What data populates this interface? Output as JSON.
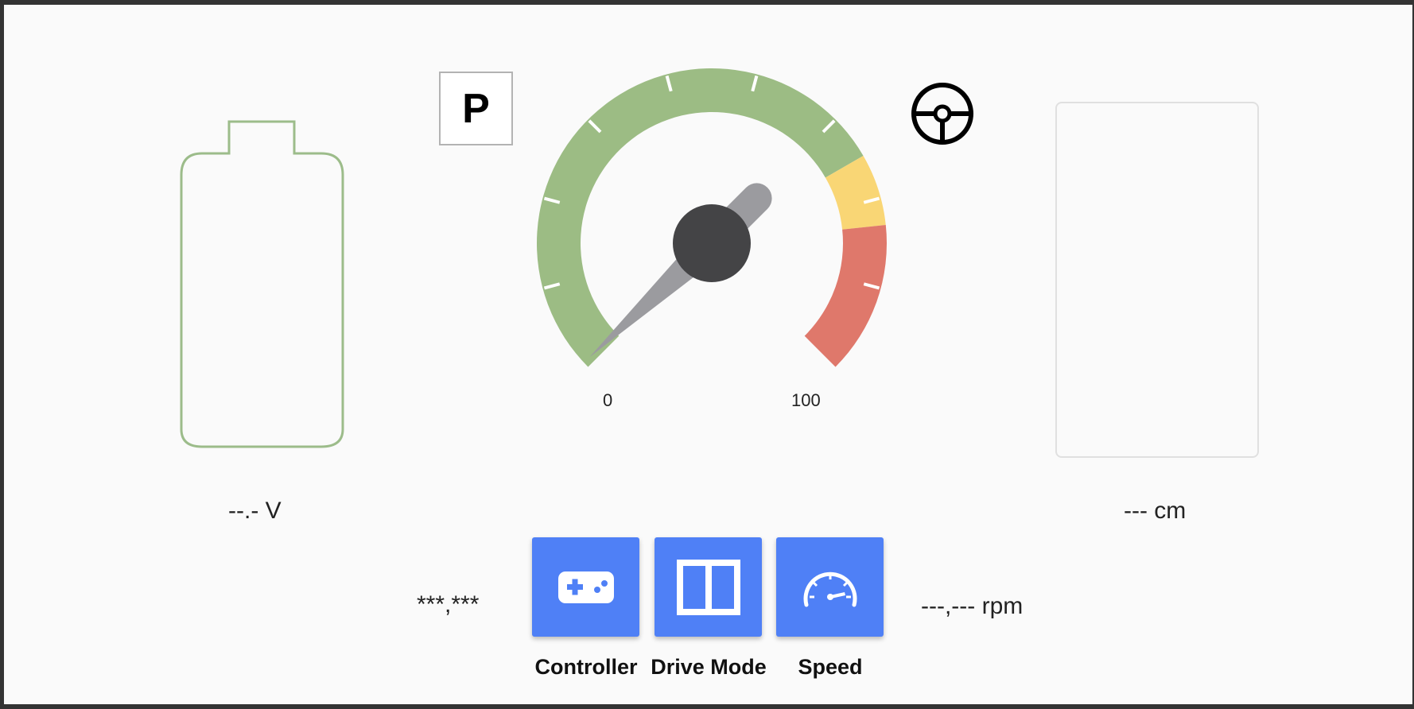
{
  "battery": {
    "voltage_text": "--.- V",
    "outline_color": "#9cbc8a"
  },
  "gear": {
    "label": "P"
  },
  "speedometer": {
    "min_label": "0",
    "max_label": "100",
    "zones": [
      {
        "name": "normal",
        "color": "#9cbc84"
      },
      {
        "name": "caution",
        "color": "#f9d675"
      },
      {
        "name": "danger",
        "color": "#df786b"
      }
    ],
    "needle_color": "#9b9b9f",
    "hub_color": "#444446"
  },
  "steering": {
    "icon": "steering-wheel-icon"
  },
  "distance": {
    "text": "--- cm"
  },
  "joystick": {
    "coords_text": "***,***"
  },
  "motor": {
    "rpm_text": "---,--- rpm"
  },
  "buttons": [
    {
      "label": "Controller",
      "icon": "gamepad-icon"
    },
    {
      "label": "Drive Mode",
      "icon": "drive-mode-icon"
    },
    {
      "label": "Speed",
      "icon": "speedometer-icon"
    }
  ],
  "accent_color": "#4f80f6"
}
